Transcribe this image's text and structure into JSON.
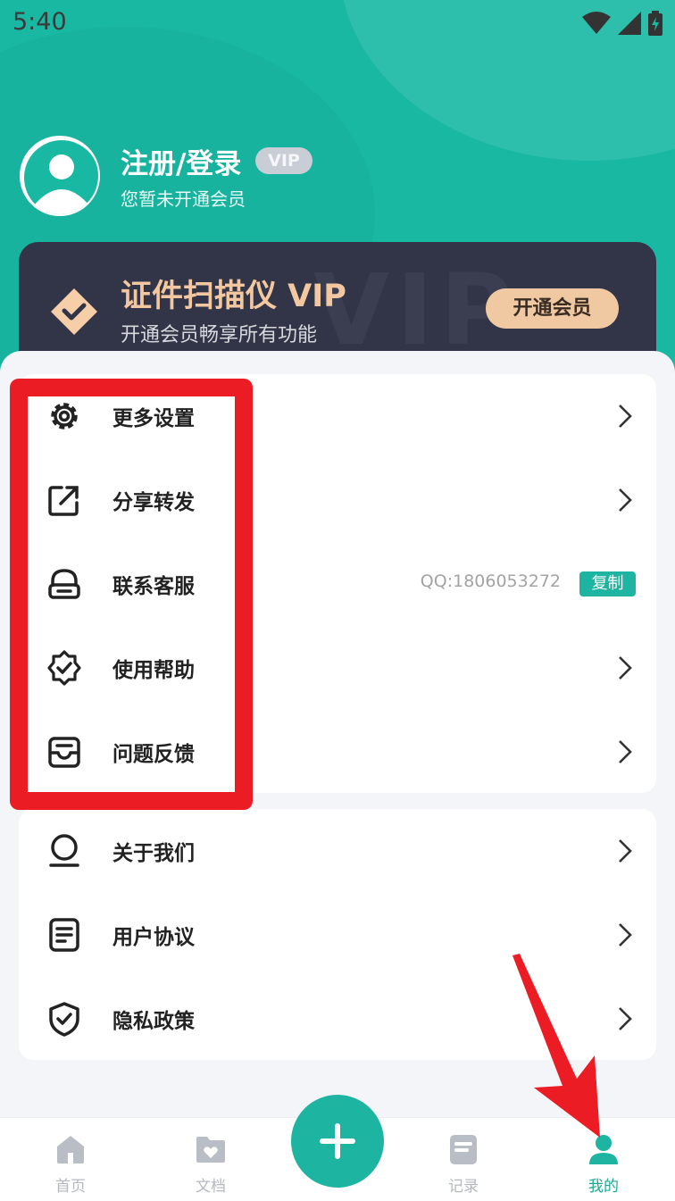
{
  "status_bar": {
    "time": "5:40"
  },
  "profile": {
    "name": "注册/登录",
    "vip_badge": "VIP",
    "subtitle": "您暂未开通会员"
  },
  "vip_card": {
    "title": "证件扫描仪 VIP",
    "subtitle": "开通会员畅享所有功能",
    "button": "开通会员",
    "watermark": "VIP"
  },
  "menu_group_1": [
    {
      "label": "更多设置",
      "icon": "gear-icon"
    },
    {
      "label": "分享转发",
      "icon": "share-icon"
    },
    {
      "label": "联系客服",
      "icon": "headset-icon",
      "value": "QQ:1806053272",
      "action": "复制"
    },
    {
      "label": "使用帮助",
      "icon": "help-badge-icon"
    },
    {
      "label": "问题反馈",
      "icon": "inbox-icon"
    }
  ],
  "menu_group_2": [
    {
      "label": "关于我们",
      "icon": "about-icon"
    },
    {
      "label": "用户协议",
      "icon": "document-icon"
    },
    {
      "label": "隐私政策",
      "icon": "shield-icon"
    }
  ],
  "tab_bar": [
    {
      "label": "首页",
      "icon": "home-icon",
      "active": false
    },
    {
      "label": "文档",
      "icon": "folder-heart-icon",
      "active": false
    },
    {
      "label": "记录",
      "icon": "record-icon",
      "active": false
    },
    {
      "label": "我的",
      "icon": "user-icon",
      "active": true
    }
  ],
  "colors": {
    "primary": "#1db5a1",
    "vip_card_bg": "#323547",
    "vip_gold": "#f3c7a0",
    "annotation_red": "#ec1c24"
  }
}
